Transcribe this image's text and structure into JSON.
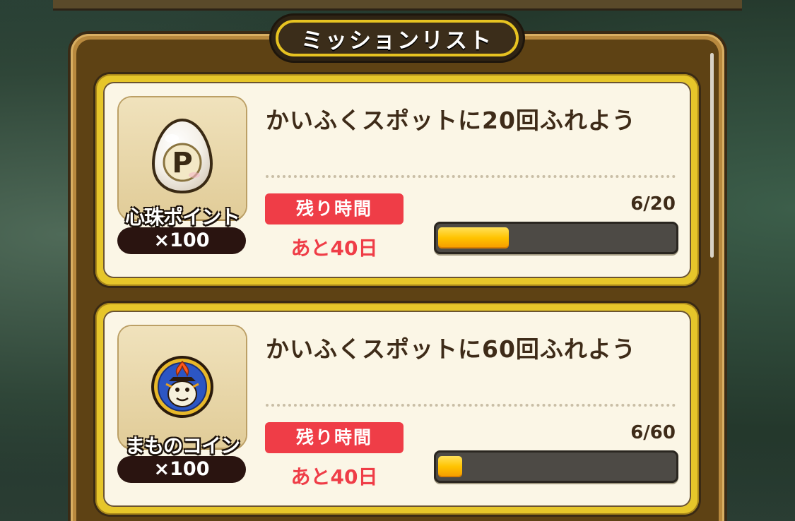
{
  "panel": {
    "title": "ミッションリスト"
  },
  "missions": [
    {
      "title": "かいふくスポットに20回ふれよう",
      "reward_name": "心珠ポイント",
      "reward_qty": "×100",
      "reward_icon": "heart-orb-point-icon",
      "time_badge": "残り時間",
      "time_left": "あと40日",
      "progress_text": "6/20",
      "progress_fraction": 0.3
    },
    {
      "title": "かいふくスポットに60回ふれよう",
      "reward_name": "まものコイン",
      "reward_qty": "×100",
      "reward_icon": "monster-coin-icon",
      "time_badge": "残り時間",
      "time_left": "あと40日",
      "progress_text": "6/60",
      "progress_fraction": 0.1
    }
  ],
  "colors": {
    "accent_red": "#ef3d47",
    "gold_border": "#e6c62a",
    "progress_fill": "#ffc300",
    "frame_brown": "#5e4214"
  }
}
